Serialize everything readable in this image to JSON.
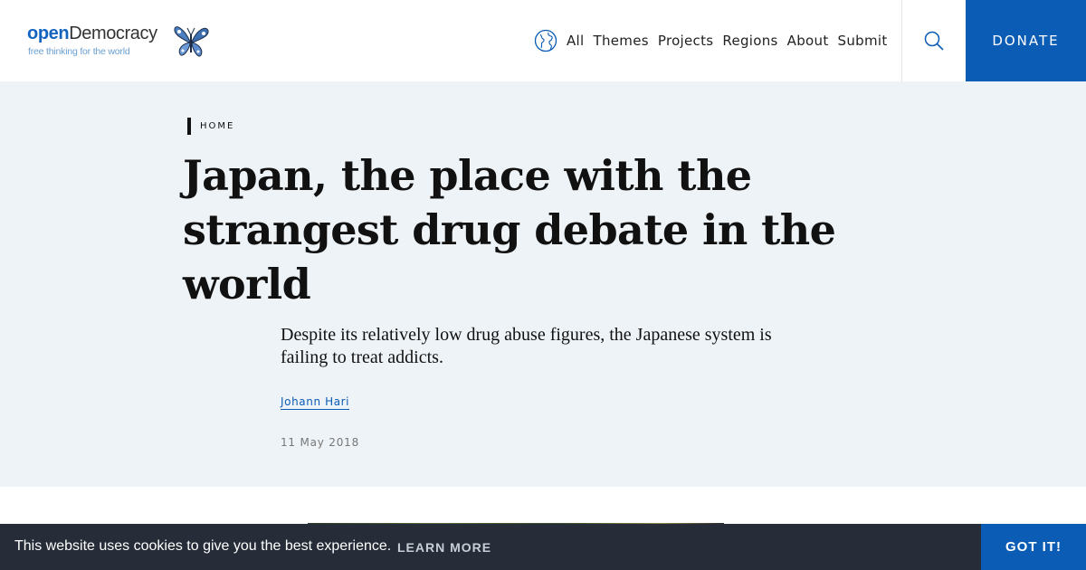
{
  "header": {
    "logo": {
      "word_bold": "open",
      "word_rest": "Democracy",
      "tagline": "free thinking for the world"
    },
    "nav": [
      {
        "label": "All"
      },
      {
        "label": "Themes"
      },
      {
        "label": "Projects"
      },
      {
        "label": "Regions"
      },
      {
        "label": "About"
      },
      {
        "label": "Submit"
      }
    ],
    "search_icon": "search-icon",
    "globe_icon": "globe-icon",
    "donate_label": "DONATE"
  },
  "article": {
    "breadcrumb": "HOME",
    "title": "Japan, the place with the strangest drug debate in the world",
    "standfirst": "Despite its relatively low drug abuse figures, the Japanese system is failing to treat addicts.",
    "author": "Johann Hari",
    "date": "11 May 2018"
  },
  "cookie": {
    "message": "This website uses cookies to give you the best experience.",
    "learn_more": "LEARN MORE",
    "accept": "GOT IT!"
  },
  "colors": {
    "brand_blue": "#0b5cb5",
    "hero_bg": "#eef3f7",
    "cookie_bg": "#262d38"
  }
}
